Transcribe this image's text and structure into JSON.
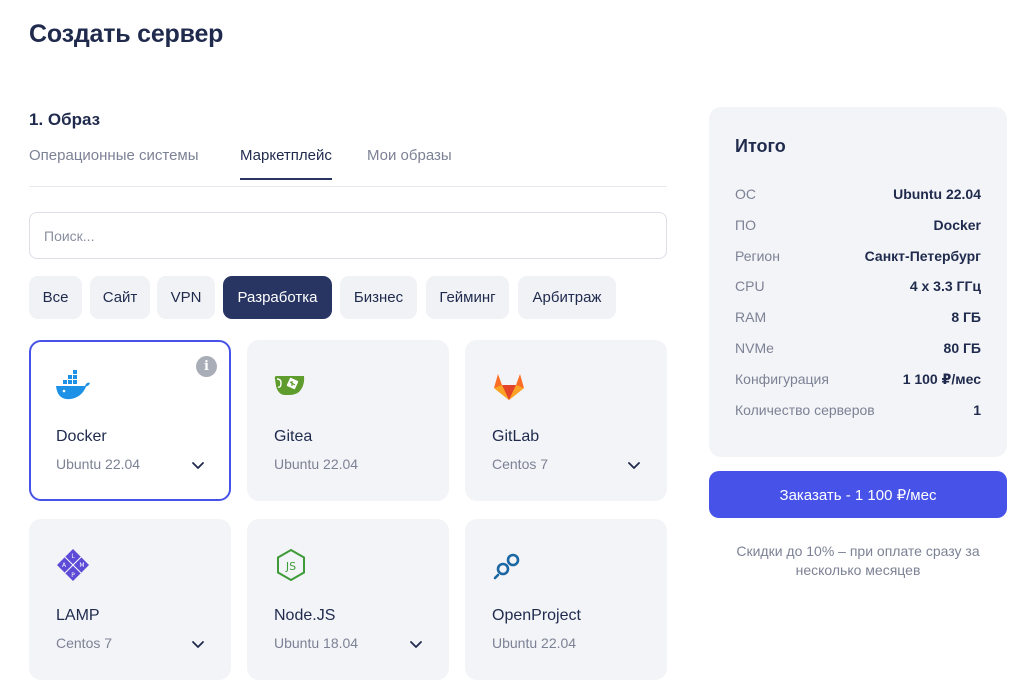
{
  "page": {
    "title": "Создать сервер"
  },
  "image_section": {
    "title": "1. Образ",
    "tabs": [
      {
        "label": "Операционные системы",
        "active": false
      },
      {
        "label": "Маркетплейс",
        "active": true
      },
      {
        "label": "Мои образы",
        "active": false
      }
    ],
    "search": {
      "placeholder": "Поиск...",
      "value": ""
    },
    "chips": [
      {
        "label": "Все",
        "active": false
      },
      {
        "label": "Сайт",
        "active": false
      },
      {
        "label": "VPN",
        "active": false
      },
      {
        "label": "Разработка",
        "active": true
      },
      {
        "label": "Бизнес",
        "active": false
      },
      {
        "label": "Гейминг",
        "active": false
      },
      {
        "label": "Арбитраж",
        "active": false
      }
    ],
    "cards": [
      {
        "name": "Docker",
        "os": "Ubuntu 22.04",
        "icon": "docker-icon",
        "selected": true,
        "has_dropdown": true,
        "has_info": true,
        "info_glyph": "i"
      },
      {
        "name": "Gitea",
        "os": "Ubuntu 22.04",
        "icon": "gitea-icon",
        "selected": false,
        "has_dropdown": false
      },
      {
        "name": "GitLab",
        "os": "Centos 7",
        "icon": "gitlab-icon",
        "selected": false,
        "has_dropdown": true
      },
      {
        "name": "LAMP",
        "os": "Centos 7",
        "icon": "lamp-icon",
        "selected": false,
        "has_dropdown": true
      },
      {
        "name": "Node.JS",
        "os": "Ubuntu 18.04",
        "icon": "nodejs-icon",
        "selected": false,
        "has_dropdown": true
      },
      {
        "name": "OpenProject",
        "os": "Ubuntu 22.04",
        "icon": "openproject-icon",
        "selected": false,
        "has_dropdown": false
      }
    ]
  },
  "summary": {
    "title": "Итого",
    "rows": [
      {
        "label": "ОС",
        "value": "Ubuntu 22.04"
      },
      {
        "label": "ПО",
        "value": "Docker"
      },
      {
        "label": "Регион",
        "value": "Санкт-Петербург"
      },
      {
        "label": "CPU",
        "value": "4 x 3.3 ГГц"
      },
      {
        "label": "RAM",
        "value": "8 ГБ"
      },
      {
        "label": "NVMe",
        "value": "80 ГБ"
      },
      {
        "label": "Конфигурация",
        "value": "1 100 ₽/мес"
      },
      {
        "label": "Количество серверов",
        "value": "1"
      }
    ],
    "order_button": "Заказать - 1 100 ₽/мес",
    "discount_note": "Скидки до 10% – при оплате сразу за несколько месяцев"
  },
  "colors": {
    "accent": "#4753e8",
    "dark_chip": "#283462",
    "card_bg": "#f3f4f7",
    "docker": "#1d91e6",
    "gitea": "#5e9c2e",
    "gitlab": "#fc6d26",
    "lamp": "#5b4bd6",
    "nodejs": "#3f9b3a",
    "openproject": "#1a67a3"
  }
}
